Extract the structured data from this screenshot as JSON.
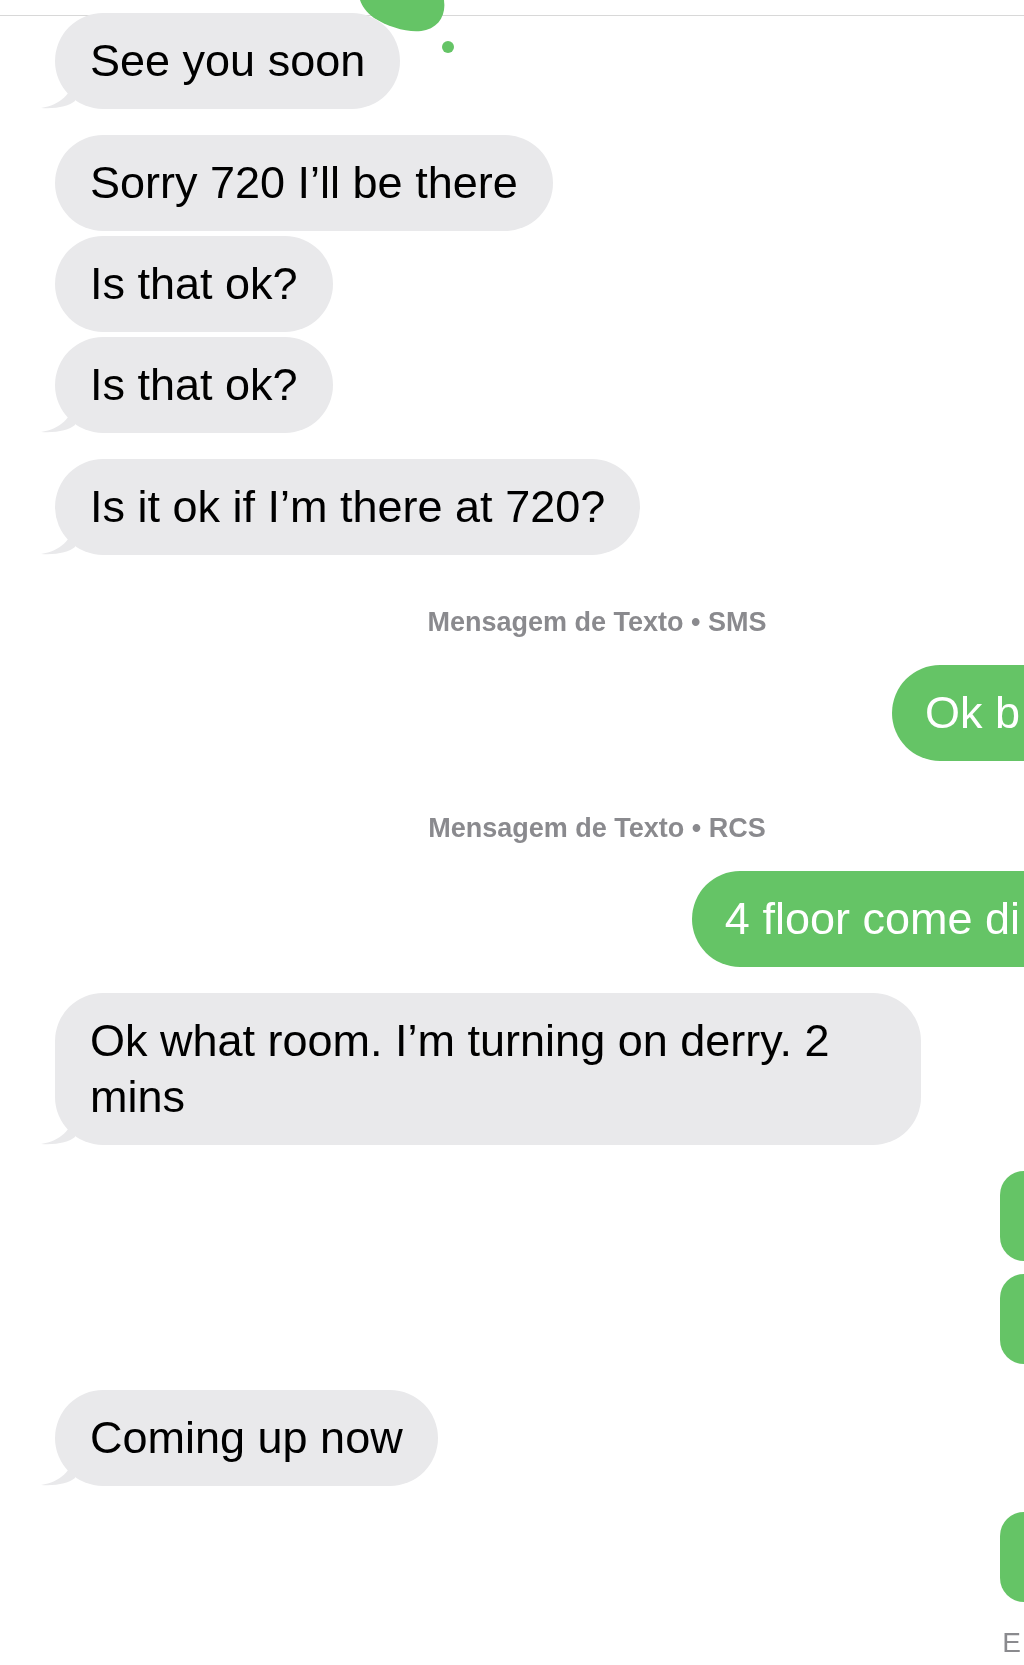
{
  "messages": [
    {
      "kind": "received",
      "text": "See you soon",
      "tail": true
    },
    {
      "kind": "received",
      "text": "Sorry 720 I’ll be there",
      "tail": false
    },
    {
      "kind": "received",
      "text": "Is that ok?",
      "tail": false
    },
    {
      "kind": "received",
      "text": "Is that ok?",
      "tail": true
    },
    {
      "kind": "received",
      "text": "Is it ok if I’m there at 720?",
      "tail": true
    },
    {
      "kind": "timestamp",
      "text": "Mensagem de Texto • SMS"
    },
    {
      "kind": "sent",
      "text": "Ok b"
    },
    {
      "kind": "timestamp",
      "text": "Mensagem de Texto • RCS"
    },
    {
      "kind": "sent",
      "text": "4 floor come di"
    },
    {
      "kind": "received",
      "text": "Ok what room. I’m turning on derry. 2 mins",
      "tail": true
    },
    {
      "kind": "sent_hidden"
    },
    {
      "kind": "sent_hidden"
    },
    {
      "kind": "received",
      "text": "Coming up now",
      "tail": true
    },
    {
      "kind": "sent_hidden"
    },
    {
      "kind": "status",
      "text": "E"
    }
  ]
}
